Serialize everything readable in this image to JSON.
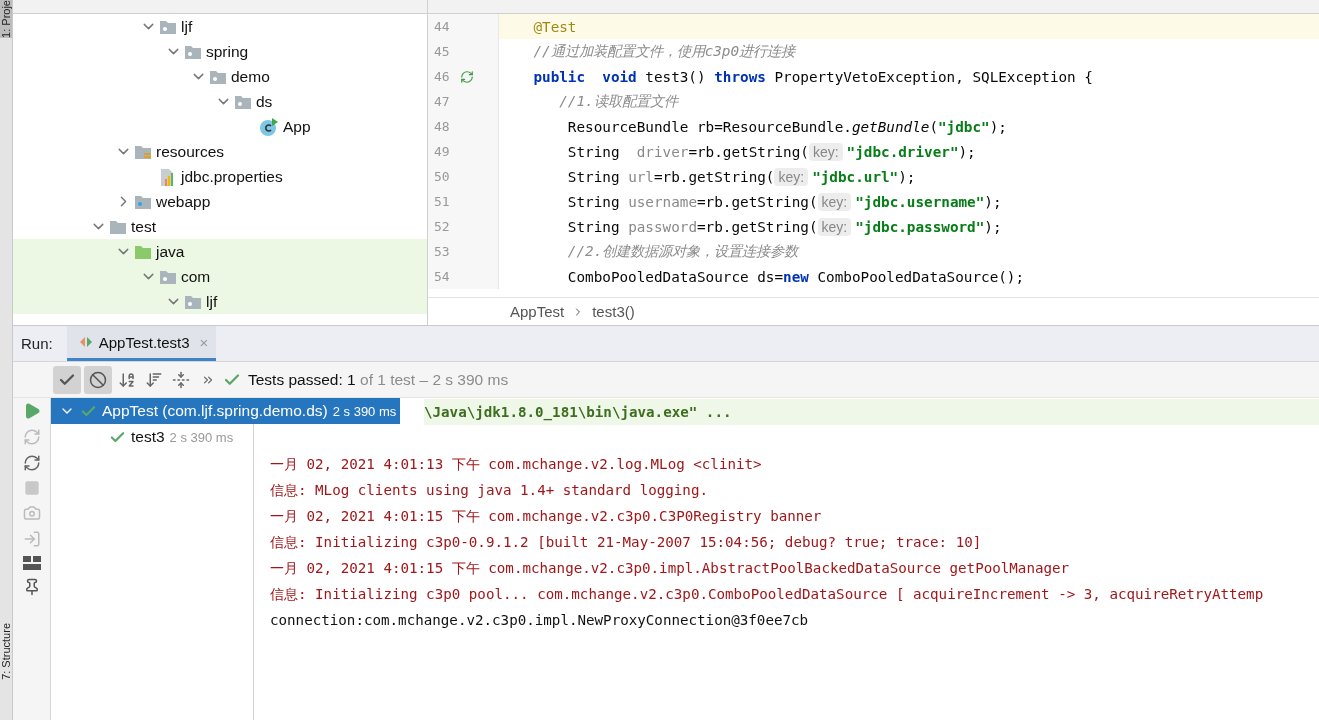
{
  "side_strip": {
    "top_label": "1: Proje",
    "bottom_label": "7: Structure"
  },
  "project_tree": {
    "items": [
      {
        "children": [
          {
            "children": [
              {
                "label": "ljf",
                "kind": "package",
                "expanded": true,
                "test_area": false,
                "children": [
                  {
                    "label": "spring",
                    "kind": "package",
                    "expanded": true,
                    "test_area": false,
                    "children": [
                      {
                        "label": "demo",
                        "kind": "package",
                        "expanded": true,
                        "test_area": false,
                        "children": [
                          {
                            "label": "ds",
                            "kind": "package",
                            "expanded": true,
                            "test_area": false,
                            "children": [
                              {
                                "label": "App",
                                "kind": "class",
                                "test_area": false
                              }
                            ]
                          }
                        ]
                      }
                    ]
                  }
                ]
              }
            ]
          },
          {
            "label": "resources",
            "kind": "resources",
            "expanded": true,
            "test_area": false,
            "children": [
              {
                "label": "jdbc.properties",
                "kind": "properties",
                "test_area": false
              }
            ]
          },
          {
            "label": "webapp",
            "kind": "web",
            "expanded": false,
            "test_area": false
          }
        ]
      },
      {
        "label": "test",
        "kind": "folder",
        "expanded": true,
        "test_area": false,
        "children": [
          {
            "label": "java",
            "kind": "test_root",
            "expanded": true,
            "test_area": true,
            "children": [
              {
                "label": "com",
                "kind": "package",
                "expanded": true,
                "test_area": true,
                "children": [
                  {
                    "label": "ljf",
                    "kind": "package",
                    "expanded": true,
                    "test_area": true
                  }
                ]
              }
            ]
          }
        ]
      }
    ]
  },
  "editor": {
    "lines": [
      {
        "number": "44",
        "current": true,
        "runnable": false,
        "segments": [
          {
            "kind": "ann",
            "text": "    @Test"
          }
        ]
      },
      {
        "number": "45",
        "current": false,
        "runnable": false,
        "segments": [
          {
            "kind": "comment",
            "text": "    //通过加装配置文件，使用c3p0进行连接"
          }
        ]
      },
      {
        "number": "46",
        "current": false,
        "runnable": true,
        "segments": [
          {
            "kind": "kw",
            "text": "    public  void "
          },
          {
            "kind": "plain",
            "text": "test3() "
          },
          {
            "kind": "kw",
            "text": "throws "
          },
          {
            "kind": "plain",
            "text": "PropertyVetoException, SQLException {"
          }
        ]
      },
      {
        "number": "47",
        "current": false,
        "runnable": false,
        "segments": [
          {
            "kind": "comment",
            "text": "       //1.读取配置文件"
          }
        ]
      },
      {
        "number": "48",
        "current": false,
        "runnable": false,
        "segments": [
          {
            "kind": "plain",
            "text": "        ResourceBundle rb=ResourceBundle."
          },
          {
            "kind": "italic",
            "text": "getBundle"
          },
          {
            "kind": "plain",
            "text": "("
          },
          {
            "kind": "str",
            "text": "\"jdbc\""
          },
          {
            "kind": "plain",
            "text": ");"
          }
        ]
      },
      {
        "number": "49",
        "current": false,
        "runnable": false,
        "segments": [
          {
            "kind": "plain",
            "text": "        String  "
          },
          {
            "kind": "unused",
            "text": "driver"
          },
          {
            "kind": "plain",
            "text": "=rb.getString("
          },
          {
            "kind": "hint",
            "text": "key:"
          },
          {
            "kind": "str",
            "text": "\"jdbc.driver\""
          },
          {
            "kind": "plain",
            "text": ");"
          }
        ]
      },
      {
        "number": "50",
        "current": false,
        "runnable": false,
        "segments": [
          {
            "kind": "plain",
            "text": "        String "
          },
          {
            "kind": "unused",
            "text": "url"
          },
          {
            "kind": "plain",
            "text": "=rb.getString("
          },
          {
            "kind": "hint",
            "text": "key:"
          },
          {
            "kind": "str",
            "text": "\"jdbc.url\""
          },
          {
            "kind": "plain",
            "text": ");"
          }
        ]
      },
      {
        "number": "51",
        "current": false,
        "runnable": false,
        "segments": [
          {
            "kind": "plain",
            "text": "        String "
          },
          {
            "kind": "unused",
            "text": "username"
          },
          {
            "kind": "plain",
            "text": "=rb.getString("
          },
          {
            "kind": "hint",
            "text": "key:"
          },
          {
            "kind": "str",
            "text": "\"jdbc.username\""
          },
          {
            "kind": "plain",
            "text": ");"
          }
        ]
      },
      {
        "number": "52",
        "current": false,
        "runnable": false,
        "segments": [
          {
            "kind": "plain",
            "text": "        String "
          },
          {
            "kind": "unused",
            "text": "password"
          },
          {
            "kind": "plain",
            "text": "=rb.getString("
          },
          {
            "kind": "hint",
            "text": "key:"
          },
          {
            "kind": "str",
            "text": "\"jdbc.password\""
          },
          {
            "kind": "plain",
            "text": ");"
          }
        ]
      },
      {
        "number": "53",
        "current": false,
        "runnable": false,
        "segments": [
          {
            "kind": "comment",
            "text": "        //2.创建数据源对象，设置连接参数"
          }
        ]
      },
      {
        "number": "54",
        "current": false,
        "runnable": false,
        "segments": [
          {
            "kind": "plain",
            "text": "        ComboPooledDataSource ds="
          },
          {
            "kind": "kw",
            "text": "new "
          },
          {
            "kind": "plain",
            "text": "ComboPooledDataSource();"
          }
        ]
      }
    ],
    "breadcrumbs": [
      "AppTest",
      "test3()"
    ]
  },
  "run_panel": {
    "label": "Run:",
    "tabs": [
      {
        "label": "AppTest.test3",
        "selected": true,
        "close": "×"
      }
    ],
    "toolbar": {
      "show_passed": true,
      "show_ignored": true,
      "status_bold": "Tests passed: 1",
      "status_rest": " of 1 test – 2 s 390 ms"
    },
    "tests": [
      {
        "name": "AppTest (com.ljf.spring.demo.ds)",
        "time": "2 s 390 ms",
        "selected": true,
        "expanded": true,
        "passed": true,
        "children": [
          {
            "name": "test3",
            "time": "2 s 390 ms",
            "selected": false,
            "passed": true
          }
        ]
      }
    ],
    "console": [
      {
        "kind": "command",
        "text": "\\Java\\jdk1.8.0_181\\bin\\java.exe\" ..."
      },
      {
        "kind": "blank"
      },
      {
        "kind": "err",
        "text": "一月 02, 2021 4:01:13 下午 com.mchange.v2.log.MLog <clinit>"
      },
      {
        "kind": "err",
        "text": "信息: MLog clients using java 1.4+ standard logging."
      },
      {
        "kind": "err",
        "text": "一月 02, 2021 4:01:15 下午 com.mchange.v2.c3p0.C3P0Registry banner"
      },
      {
        "kind": "err",
        "text": "信息: Initializing c3p0-0.9.1.2 [built 21-May-2007 15:04:56; debug? true; trace: 10]"
      },
      {
        "kind": "err",
        "text": "一月 02, 2021 4:01:15 下午 com.mchange.v2.c3p0.impl.AbstractPoolBackedDataSource getPoolManager"
      },
      {
        "kind": "err",
        "text": "信息: Initializing c3p0 pool... com.mchange.v2.c3p0.ComboPooledDataSource [ acquireIncrement -> 3, acquireRetryAttemp"
      },
      {
        "kind": "out",
        "text": "connection:com.mchange.v2.c3p0.impl.NewProxyConnection@3f0ee7cb"
      }
    ]
  }
}
